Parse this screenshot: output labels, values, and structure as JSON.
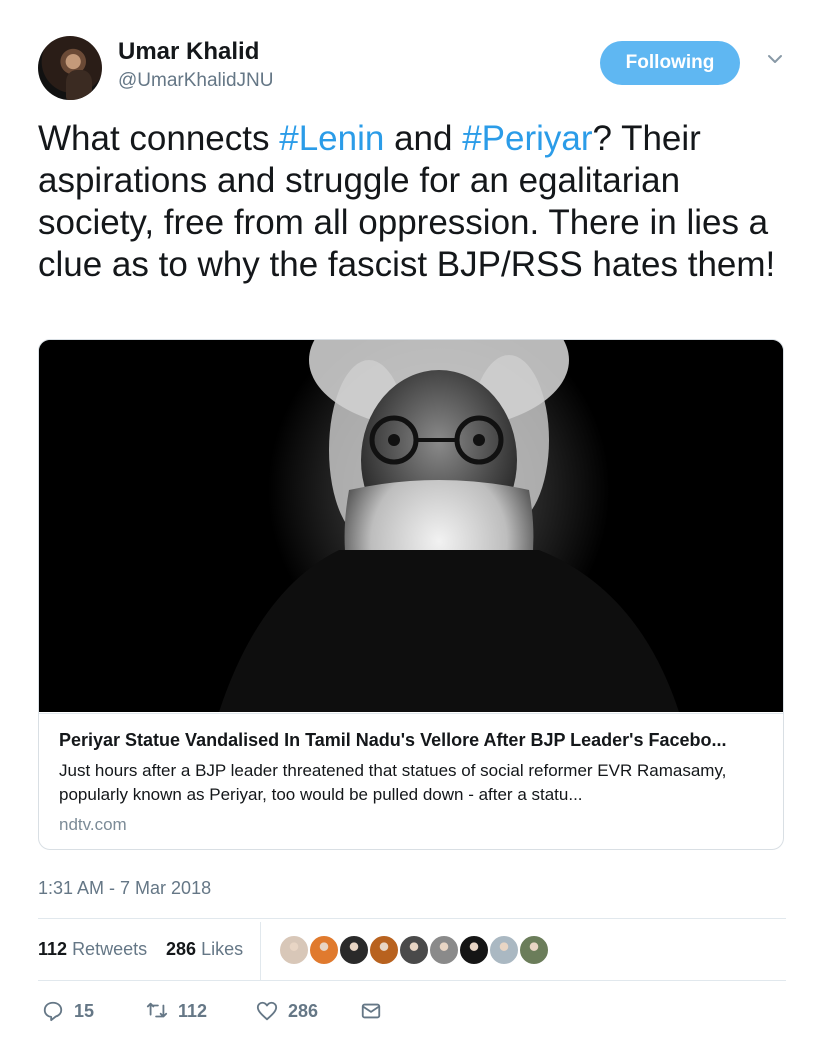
{
  "author": {
    "name": "Umar Khalid",
    "handle": "@UmarKhalidJNU"
  },
  "follow_button": {
    "label": "Following"
  },
  "tweet": {
    "text_parts": [
      {
        "text": "What connects ",
        "hashtag": false
      },
      {
        "text": "#Lenin",
        "hashtag": true
      },
      {
        "text": " and ",
        "hashtag": false
      },
      {
        "text": "#Periyar",
        "hashtag": true
      },
      {
        "text": "? Their aspirations and struggle for an egalitarian society, free from all oppression. There in lies a clue as to why the fascist BJP/RSS hates them!",
        "hashtag": false
      }
    ]
  },
  "card": {
    "title": "Periyar Statue Vandalised In Tamil Nadu's Vellore After BJP Leader's Facebo...",
    "description": "Just hours after a BJP leader threatened that statues of social reformer EVR Ramasamy, popularly known as Periyar, too would be pulled down - after a statu...",
    "domain": "ndtv.com"
  },
  "timestamp": "1:31 AM - 7 Mar 2018",
  "stats": {
    "retweets_count": "112",
    "retweets_label": "Retweets",
    "likes_count": "286",
    "likes_label": "Likes"
  },
  "liker_avatars": [
    {
      "color": "#d8c7b8"
    },
    {
      "color": "#e07a2e"
    },
    {
      "color": "#2a2a2a"
    },
    {
      "color": "#b8621f"
    },
    {
      "color": "#4a4a4a"
    },
    {
      "color": "#8a8a8a"
    },
    {
      "color": "#151515"
    },
    {
      "color": "#aab8c2"
    },
    {
      "color": "#6b7d5a"
    }
  ],
  "actions": {
    "reply_count": "15",
    "retweet_count": "112",
    "like_count": "286"
  },
  "colors": {
    "link": "#2b9ce8",
    "follow_button_bg": "#5fb7f2",
    "muted_text": "#657786"
  },
  "icons": [
    "chevron-down-icon",
    "reply-icon",
    "retweet-icon",
    "heart-icon",
    "message-icon"
  ]
}
